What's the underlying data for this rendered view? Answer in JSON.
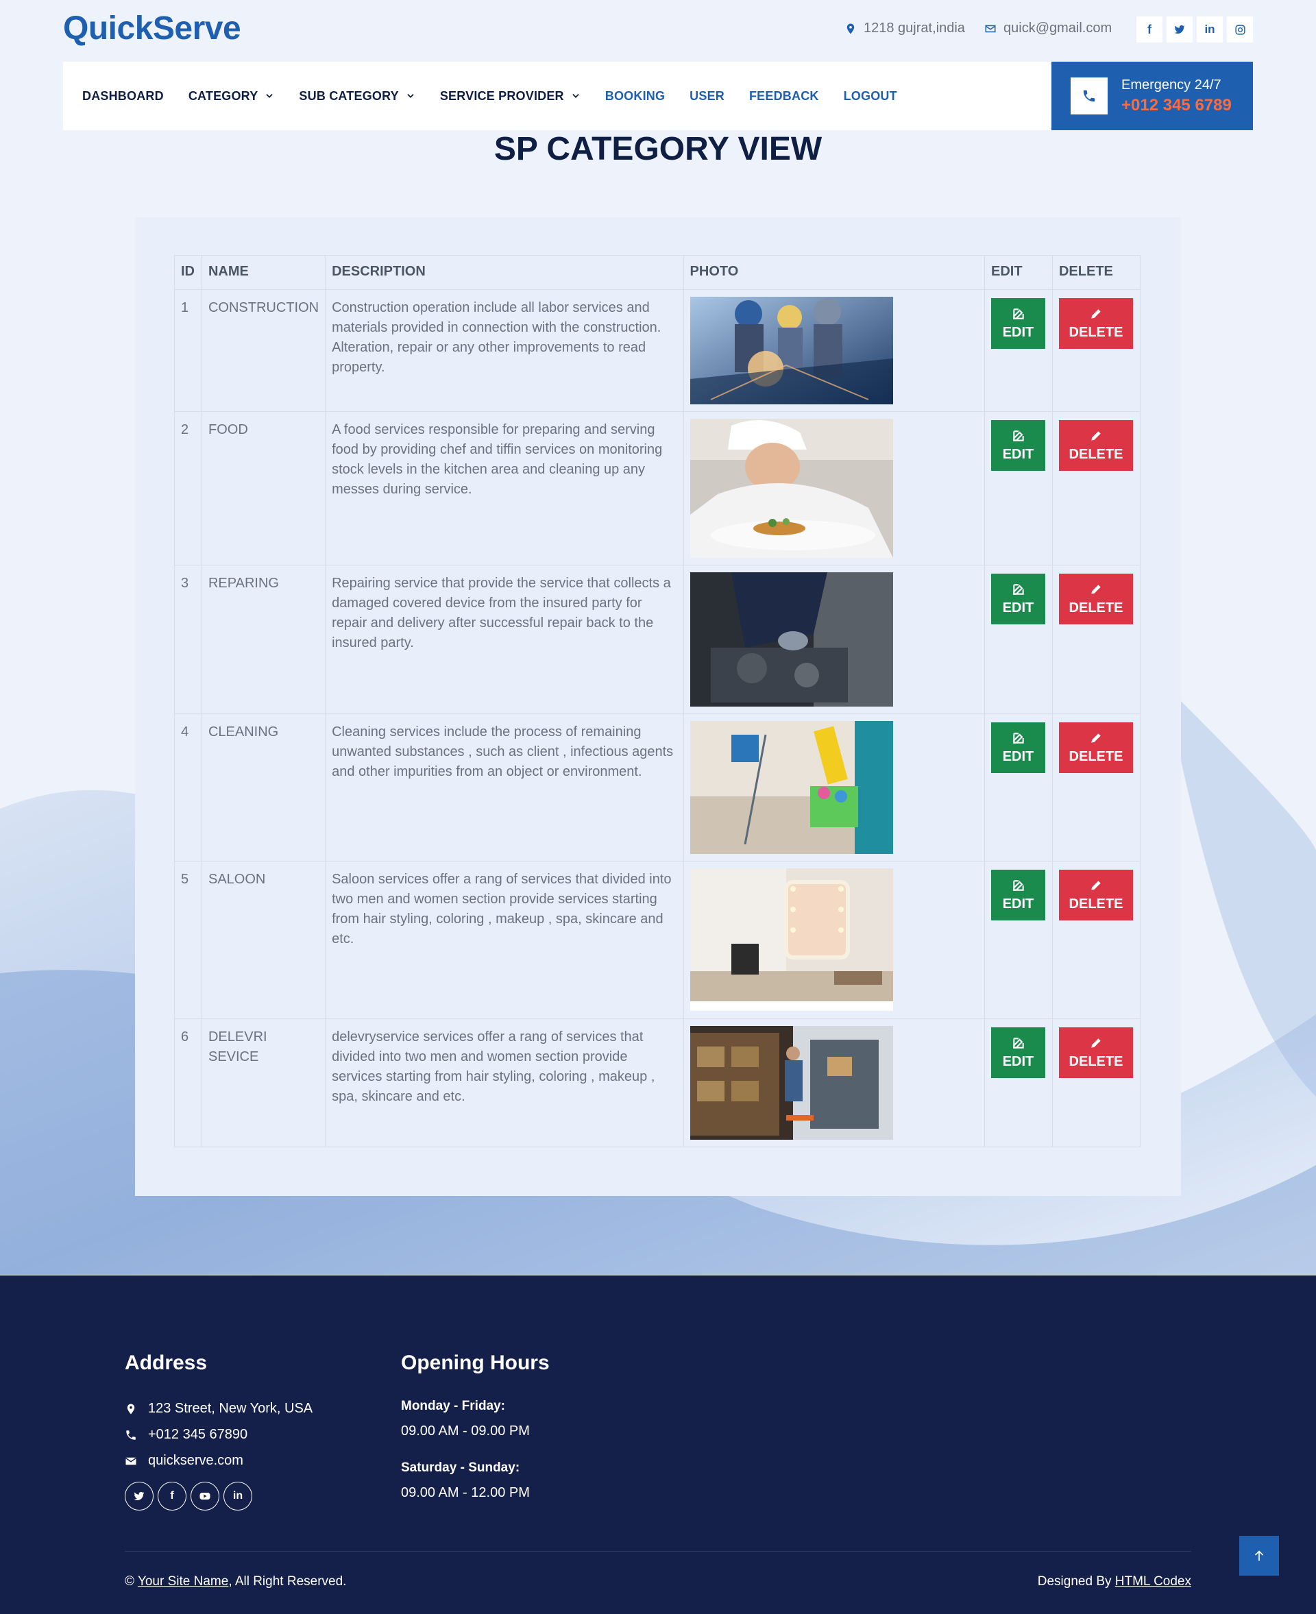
{
  "header": {
    "brand": "QuickServe",
    "address": "1218 gujrat,india",
    "email": "quick@gmail.com",
    "socials": [
      "facebook-icon",
      "twitter-icon",
      "linkedin-icon",
      "instagram-icon"
    ]
  },
  "nav": {
    "items": [
      {
        "label": "DASHBOARD",
        "dropdown": false
      },
      {
        "label": "CATEGORY",
        "dropdown": true
      },
      {
        "label": "SUB CATEGORY",
        "dropdown": true
      },
      {
        "label": "SERVICE PROVIDER",
        "dropdown": true
      },
      {
        "label": "BOOKING",
        "dropdown": false
      },
      {
        "label": "USER",
        "dropdown": false
      },
      {
        "label": "FEEDBACK",
        "dropdown": false
      },
      {
        "label": "LOGOUT",
        "dropdown": false
      }
    ]
  },
  "emergency": {
    "label": "Emergency 24/7",
    "phone": "+012 345 6789"
  },
  "page": {
    "title": "SP CATEGORY VIEW"
  },
  "table": {
    "headers": [
      "ID",
      "NAME",
      "DESCRIPTION",
      "PHOTO",
      "EDIT",
      "DELETE"
    ],
    "edit_label": "EDIT",
    "delete_label": "DELETE",
    "rows": [
      {
        "id": "1",
        "name": "CONSTRUCTION",
        "description": "Construction operation include all labor services and materials provided in connection with the construction. Alteration, repair or any other improvements to read property.",
        "photo": "construction"
      },
      {
        "id": "2",
        "name": "FOOD",
        "description": "A food services responsible for preparing and serving food by providing chef and tiffin services on monitoring stock levels in the kitchen area and cleaning up any messes during service.",
        "photo": "food"
      },
      {
        "id": "3",
        "name": "REPARING",
        "description": "Repairing service that provide the service that collects a damaged covered device from the insured party for repair and delivery after successful repair back to the insured party.",
        "photo": "repairing"
      },
      {
        "id": "4",
        "name": "CLEANING",
        "description": "Cleaning services include the process of remaining unwanted substances , such as client , infectious agents and other impurities from an object or environment.",
        "photo": "cleaning"
      },
      {
        "id": "5",
        "name": "SALOON",
        "description": "Saloon services offer a rang of services that divided into two men and women section provide services starting from hair styling, coloring , makeup , spa, skincare and etc.",
        "photo": "saloon"
      },
      {
        "id": "6",
        "name": "DELEVRI SEVICE",
        "description": "delevryservice services offer a rang of services that divided into two men and women section provide services starting from hair styling, coloring , makeup , spa, skincare and etc.",
        "photo": "delivery"
      }
    ]
  },
  "footer": {
    "address_title": "Address",
    "street": "123 Street, New York, USA",
    "phone": "+012 345 67890",
    "site": "quickserve.com",
    "socials": [
      "twitter-icon",
      "facebook-icon",
      "youtube-icon",
      "linkedin-icon"
    ],
    "hours_title": "Opening Hours",
    "weekday_label": "Monday - Friday:",
    "weekday_hours": "09.00 AM - 09.00 PM",
    "weekend_label": "Saturday - Sunday:",
    "weekend_hours": "09.00 AM - 12.00 PM",
    "copyright_prefix": "©",
    "copyright_link": "Your Site Name",
    "copyright_suffix": ", All Right Reserved.",
    "designed_prefix": "Designed By",
    "designed_link": "HTML Codex"
  },
  "colors": {
    "brand": "#1e5fb0",
    "dark": "#0f1f44",
    "edit": "#1a8a4d",
    "delete": "#dc3545",
    "accent": "#ff6a3d",
    "footer": "#14204a"
  }
}
